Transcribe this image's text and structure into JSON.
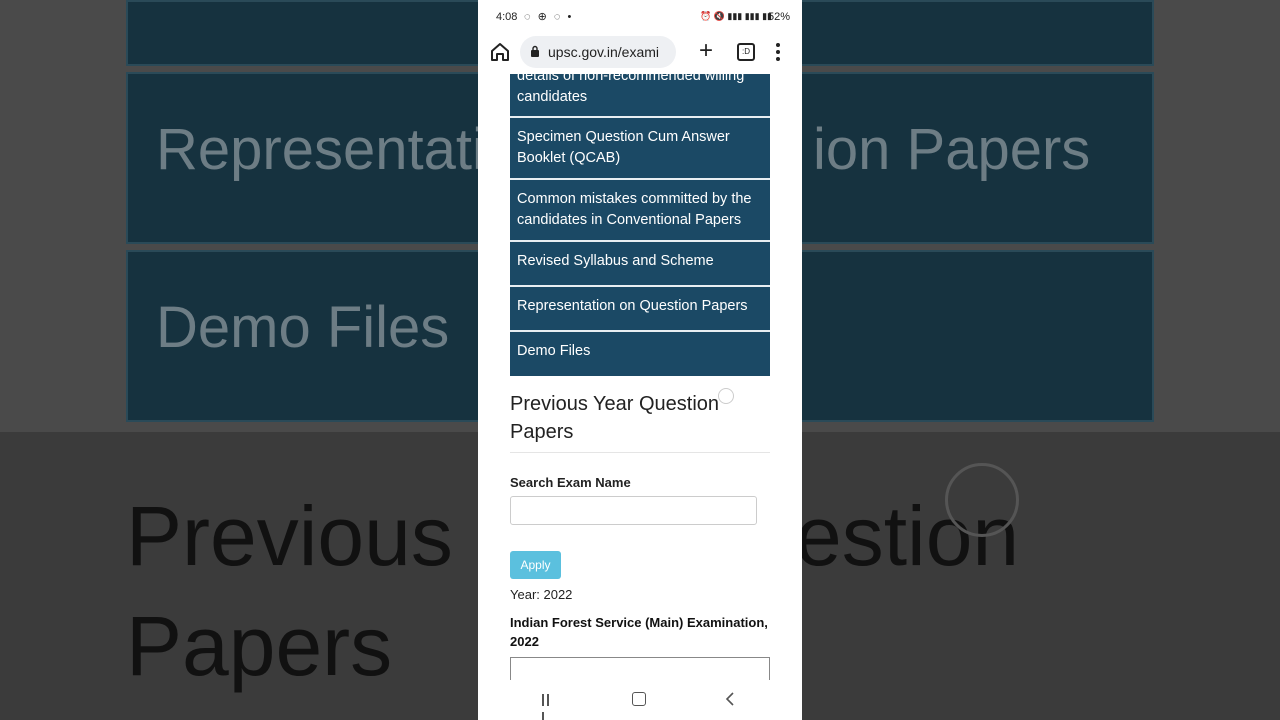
{
  "background": {
    "panel1": "Representati",
    "panel1b": "ion Papers",
    "panel2": "Demo Files",
    "big1": "Previous",
    "big1b": "estion",
    "big2": "Papers"
  },
  "status": {
    "time": "4:08",
    "battery": "52%"
  },
  "browser": {
    "url": "upsc.gov.in/exami",
    "tabs_count": ":D"
  },
  "nav_items": [
    {
      "line1": "details of non-recommended willing",
      "line2": "candidates"
    },
    {
      "line1": "Specimen Question Cum Answer",
      "line2": "Booklet (QCAB)"
    },
    {
      "line1": "Common mistakes committed by the",
      "line2": "candidates in Conventional Papers"
    },
    {
      "line1": "Revised Syllabus and Scheme"
    },
    {
      "line1": "Representation on Question Papers"
    },
    {
      "line1": "Demo Files"
    }
  ],
  "section": {
    "title_line1": "Previous Year Question",
    "title_line2": "Papers",
    "search_label": "Search Exam Name",
    "apply_label": "Apply",
    "year_text": "Year: 2022",
    "exam_line1": "Indian Forest Service (Main) Examination,",
    "exam_line2": "2022"
  },
  "colors": {
    "nav_bg": "#1b4965",
    "apply_bg": "#5bc0de"
  }
}
